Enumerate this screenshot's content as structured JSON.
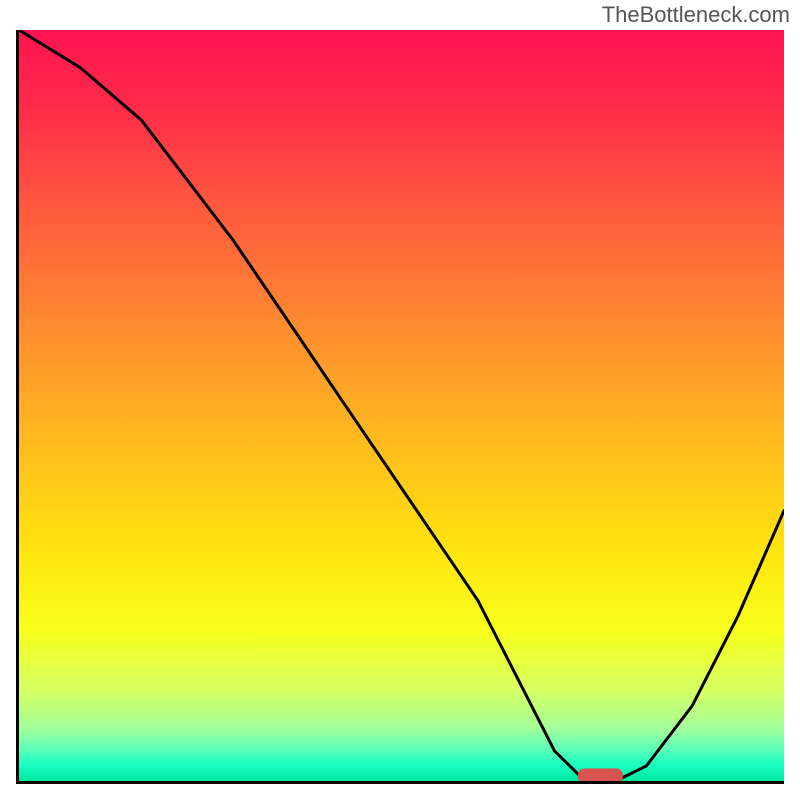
{
  "watermark": "TheBottleneck.com",
  "chart_data": {
    "type": "line",
    "title": "",
    "xlabel": "",
    "ylabel": "",
    "xlim": [
      0,
      100
    ],
    "ylim": [
      0,
      100
    ],
    "x": [
      0,
      8,
      16,
      22,
      28,
      36,
      44,
      52,
      60,
      66,
      70,
      74,
      78,
      82,
      88,
      94,
      100
    ],
    "values": [
      100,
      95,
      88,
      80,
      72,
      60,
      48,
      36,
      24,
      12,
      4,
      0,
      0,
      2,
      10,
      22,
      36
    ],
    "series_name": "bottleneck-curve",
    "marker": {
      "x": 76,
      "y": 0,
      "shape": "pill",
      "color": "#d9534f"
    },
    "background": "vertical-gradient red→green",
    "grid": false,
    "legend": false
  },
  "colors": {
    "axis": "#000000",
    "curve": "#000000",
    "marker": "#d9534f"
  }
}
